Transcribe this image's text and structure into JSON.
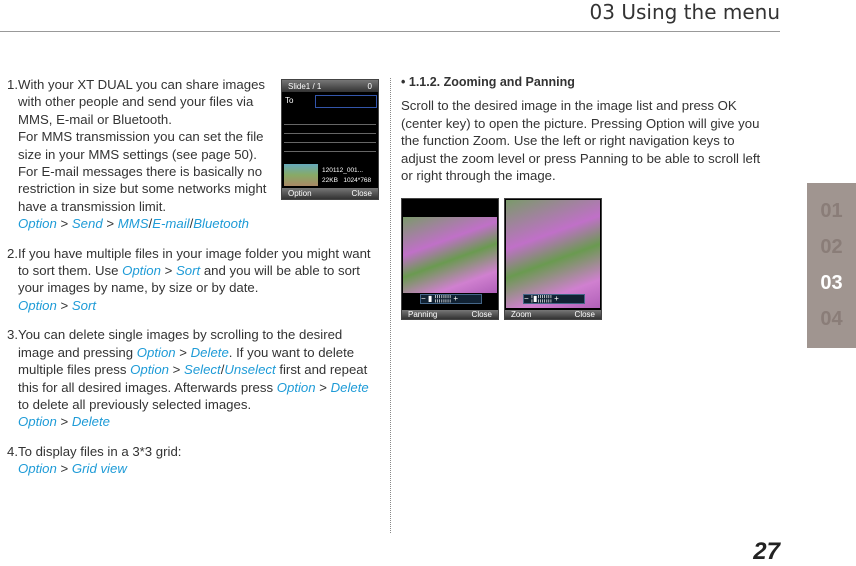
{
  "header": {
    "title": "03 Using the menu"
  },
  "items": [
    {
      "num": "1.",
      "parts": [
        {
          "t": "With your XT DUAL you can share images with other people and send your files via MMS, E-mail or Bluetooth.\nFor MMS transmission you can set the file size in your MMS settings (see page 50).\nFor E-mail messages there is basically no restriction in size but some networks might have a transmission limit.\n"
        },
        {
          "k": "Option"
        },
        {
          "t": " > "
        },
        {
          "k": "Send"
        },
        {
          "t": " > "
        },
        {
          "k": "MMS"
        },
        {
          "t": "/"
        },
        {
          "k": "E-mail"
        },
        {
          "t": "/"
        },
        {
          "k": "Bluetooth"
        }
      ]
    },
    {
      "num": "2.",
      "parts": [
        {
          "t": "If you have multiple files in your image folder you might want to sort them. Use "
        },
        {
          "k": "Option"
        },
        {
          "t": " > "
        },
        {
          "k": "Sort"
        },
        {
          "t": " and you will be able to sort your images by name, by size or by date.\n"
        },
        {
          "k": "Option"
        },
        {
          "t": " > "
        },
        {
          "k": "Sort"
        }
      ]
    },
    {
      "num": "3.",
      "parts": [
        {
          "t": "You can delete single images by scrolling to the desired image and pressing "
        },
        {
          "k": "Option"
        },
        {
          "t": " > "
        },
        {
          "k": "Delete"
        },
        {
          "t": ". If you want to delete multiple files press "
        },
        {
          "k": "Option"
        },
        {
          "t": " > "
        },
        {
          "k": "Select"
        },
        {
          "t": "/"
        },
        {
          "k": "Unselect"
        },
        {
          "t": " first and repeat this for all desired images. Afterwards press "
        },
        {
          "k": "Option"
        },
        {
          "t": " > "
        },
        {
          "k": "Delete"
        },
        {
          "t": " to delete all previously selected images.\n"
        },
        {
          "k": "Option"
        },
        {
          "t": " > "
        },
        {
          "k": "Delete"
        }
      ]
    },
    {
      "num": "4.",
      "parts": [
        {
          "t": "To display files in a 3*3 grid:\n"
        },
        {
          "k": "Option"
        },
        {
          "t": " > "
        },
        {
          "k": "Grid view"
        }
      ]
    }
  ],
  "phone1": {
    "title": "Slide1 / 1",
    "count": "0",
    "to": "To",
    "file": "120112_001...",
    "size": "22KB",
    "res": "1024*768",
    "left": "Option",
    "right": "Close"
  },
  "section": {
    "bullet": "•",
    "title": "1.1.2. Zooming and Panning",
    "body": "Scroll to the desired image in the image list and press OK (center key) to open the picture. Pressing Option will give you the function Zoom. Use the left or right navigation keys to adjust the zoom level or press Panning to be able to scroll left or right through the image."
  },
  "shots": [
    {
      "left": "Panning",
      "right": "Close"
    },
    {
      "left": "Zoom",
      "right": "Close"
    }
  ],
  "zoom_controls": {
    "minus": "−",
    "plus": "+"
  },
  "chapters": {
    "items": [
      "01",
      "02",
      "03",
      "04"
    ],
    "active": "03"
  },
  "page_number": "27",
  "colors": {
    "link": "#1e9bd7",
    "sidebar": "#a09590",
    "sidebar_text": "#8a7d78"
  }
}
